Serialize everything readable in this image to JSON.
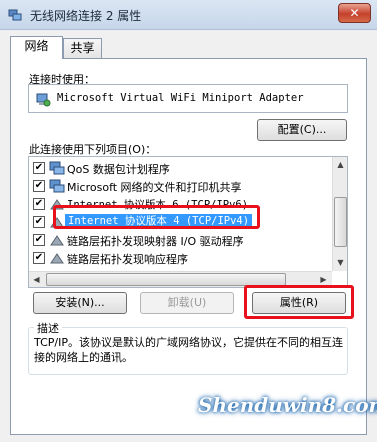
{
  "window": {
    "title": "无线网络连接 2 属性",
    "close_glyph": "✕"
  },
  "tabs": [
    {
      "label": "网络",
      "active": true
    },
    {
      "label": "共享",
      "active": false
    }
  ],
  "connect_using_label": "连接时使用：",
  "adapter_name": "Microsoft Virtual WiFi Miniport Adapter",
  "configure_button": "配置(C)...",
  "items_label": "此连接使用下列项目(O)：",
  "items": [
    {
      "label": "QoS 数据包计划程序",
      "checked": true,
      "icon": "network-component-icon"
    },
    {
      "label": "Microsoft 网络的文件和打印机共享",
      "checked": true,
      "icon": "network-component-icon"
    },
    {
      "label": "Internet 协议版本 6 (TCP/IPv6)",
      "checked": true,
      "icon": "protocol-icon"
    },
    {
      "label": "Internet 协议版本 4 (TCP/IPv4)",
      "checked": true,
      "icon": "protocol-icon",
      "selected": true
    },
    {
      "label": "链路层拓扑发现映射器 I/O 驱动程序",
      "checked": true,
      "icon": "protocol-icon"
    },
    {
      "label": "链路层拓扑发现响应程序",
      "checked": true,
      "icon": "protocol-icon"
    }
  ],
  "check_glyph": "✔",
  "buttons": {
    "install": "安装(N)...",
    "uninstall": "卸载(U)",
    "properties": "属性(R)"
  },
  "description": {
    "title": "描述",
    "text": "TCP/IP。该协议是默认的广域网络协议，它提供在不同的相互连接的网络上的通讯。"
  },
  "watermark": "Shenduwin8.com",
  "colors": {
    "highlight_border": "#e8101a",
    "selection": "#3399ff"
  }
}
